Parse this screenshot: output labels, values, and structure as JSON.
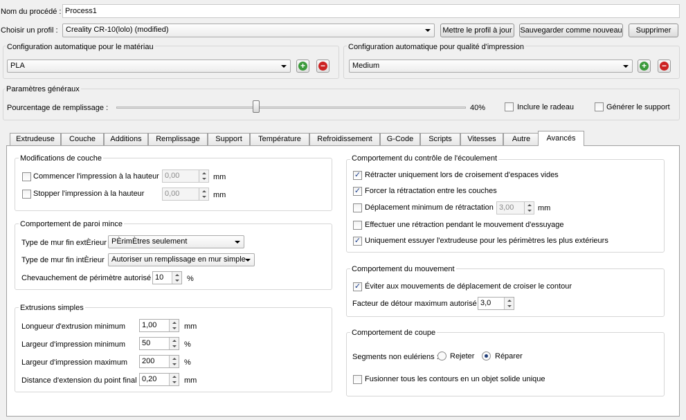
{
  "process": {
    "label": "Nom du procédé :",
    "value": "Process1"
  },
  "profile": {
    "label": "Choisir un profil :",
    "value": "Creality CR-10(lolo) (modified)",
    "update_button": "Mettre le profil à jour",
    "save_new_button": "Sauvegarder comme nouveau",
    "delete_button": "Supprimer"
  },
  "material": {
    "title": "Configuration automatique pour le matériau",
    "value": "PLA"
  },
  "quality": {
    "title": "Configuration automatique pour qualité d'impression",
    "value": "Medium"
  },
  "general": {
    "title": "Paramètres généraux",
    "infill_label": "Pourcentage de remplissage :",
    "infill_value": "40%",
    "infill_fraction": 0.4,
    "raft_label": "Inclure le radeau",
    "raft_checked": false,
    "support_label": "Générer le support",
    "support_checked": false
  },
  "tabs": [
    "Extrudeuse",
    "Couche",
    "Additions",
    "Remplissage",
    "Support",
    "Température",
    "Refroidissement",
    "G-Code",
    "Scripts",
    "Vitesses",
    "Autre",
    "Avancés"
  ],
  "active_tab": "Avancés",
  "layer_mods": {
    "title": "Modifications de couche",
    "start_label": "Commencer l'impression à la hauteur",
    "start_value": "0,00",
    "start_unit": "mm",
    "stop_label": "Stopper  l'impression à la hauteur",
    "stop_value": "0,00",
    "stop_unit": "mm"
  },
  "thin_wall": {
    "title": "Comportement de paroi mince",
    "outer_label": "Type de mur fin extÈrieur",
    "outer_value": "PÈrimÈtres seulement",
    "inner_label": "Type de mur fin intÈrieur",
    "inner_value": "Autoriser un remplissage en mur simple",
    "overlap_label": "Chevauchement de périmètre autorisé",
    "overlap_value": "10",
    "overlap_unit": "%"
  },
  "extrusions": {
    "title": "Extrusions simples",
    "rows": [
      {
        "label": "Longueur d'extrusion minimum",
        "value": "1,00",
        "unit": "mm"
      },
      {
        "label": "Largeur d'impression minimum",
        "value": "50",
        "unit": "%"
      },
      {
        "label": "Largeur d'impression maximum",
        "value": "200",
        "unit": "%"
      },
      {
        "label": "Distance d'extension du point final",
        "value": "0,20",
        "unit": "mm"
      }
    ]
  },
  "flow": {
    "title": "Comportement du contrôle de l'écoulement",
    "items": [
      {
        "label": "Rétracter uniquement lors de croisement d'espaces vides",
        "checked": true
      },
      {
        "label": "Forcer la rétractation entre les couches",
        "checked": true
      },
      {
        "label": "Déplacement minimum de rétractation",
        "checked": false
      },
      {
        "label": "Effectuer une rétraction pendant le mouvement d'essuyage",
        "checked": false
      },
      {
        "label": "Uniquement essuyer l'extrudeuse pour les périmètres les plus extérieurs",
        "checked": true
      }
    ],
    "min_travel_value": "3,00",
    "min_travel_unit": "mm"
  },
  "movement": {
    "title": "Comportement du mouvement",
    "avoid_label": "Éviter aux mouvements de déplacement de croiser le contour",
    "avoid_checked": true,
    "detour_label": "Facteur de détour maximum autorisé",
    "detour_value": "3,0"
  },
  "slicing": {
    "title": "Comportement de coupe",
    "segments_label": "Segments non eulériens :",
    "reject_label": "Rejeter",
    "repair_label": "Réparer",
    "selected": "Réparer",
    "merge_label": "Fusionner tous les contours en un objet solide unique",
    "merge_checked": false
  }
}
